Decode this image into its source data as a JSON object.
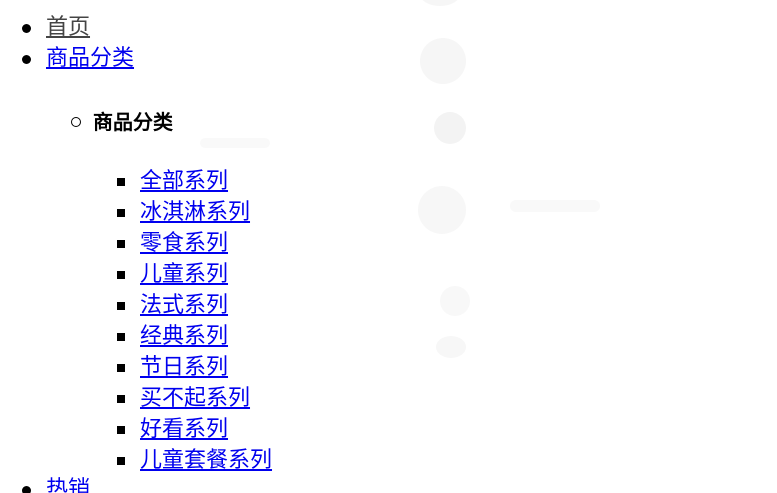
{
  "nav": {
    "home_label": "首页",
    "categories_label": "商品分类",
    "hot_label": "热销"
  },
  "submenu": {
    "title": "商品分类",
    "items": [
      {
        "label": "全部系列"
      },
      {
        "label": "冰淇淋系列"
      },
      {
        "label": "零食系列"
      },
      {
        "label": "儿童系列"
      },
      {
        "label": "法式系列"
      },
      {
        "label": "经典系列"
      },
      {
        "label": "节日系列"
      },
      {
        "label": "买不起系列"
      },
      {
        "label": "好看系列"
      },
      {
        "label": "儿童套餐系列"
      }
    ]
  },
  "colors": {
    "link": "#0000ee",
    "visited_link": "#444444",
    "text": "#000000",
    "background": "#ffffff"
  }
}
